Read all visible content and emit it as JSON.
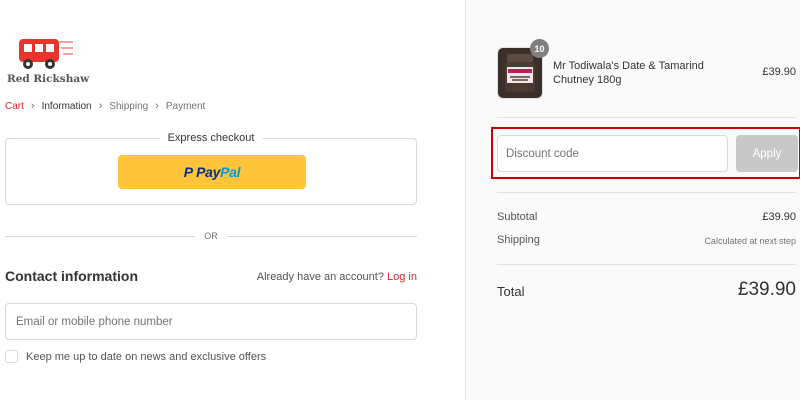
{
  "brand": {
    "name": "Red Rickshaw",
    "color": "#d8262e"
  },
  "breadcrumb": {
    "cart": "Cart",
    "information": "Information",
    "shipping": "Shipping",
    "payment": "Payment"
  },
  "express_checkout": {
    "title": "Express checkout",
    "paypal_pay": "Pay",
    "paypal_pal": "Pal"
  },
  "divider_text": "OR",
  "contact": {
    "title": "Contact information",
    "have_account": "Already have an account?",
    "login_label": "Log in",
    "email_placeholder": "Email or mobile phone number",
    "email_value": "",
    "newsletter_label": "Keep me up to date on news and exclusive offers"
  },
  "order": {
    "item": {
      "name": "Mr Todiwala's Date & Tamarind Chutney 180g",
      "price": "£39.90",
      "quantity": "10"
    },
    "discount": {
      "placeholder": "Discount code",
      "value": "",
      "apply_label": "Apply"
    },
    "subtotal_label": "Subtotal",
    "subtotal_value": "£39.90",
    "shipping_label": "Shipping",
    "shipping_value": "Calculated at next step",
    "total_label": "Total",
    "total_value": "£39.90"
  }
}
